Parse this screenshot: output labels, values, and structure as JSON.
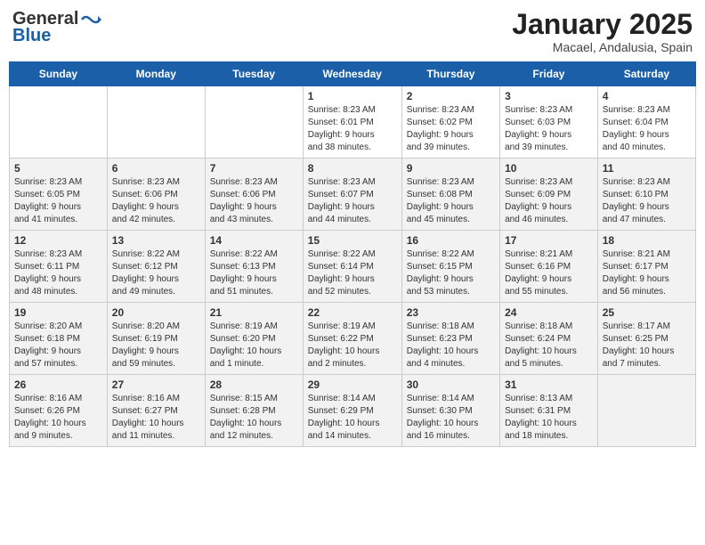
{
  "header": {
    "logo_general": "General",
    "logo_blue": "Blue",
    "month_title": "January 2025",
    "location": "Macael, Andalusia, Spain"
  },
  "days_of_week": [
    "Sunday",
    "Monday",
    "Tuesday",
    "Wednesday",
    "Thursday",
    "Friday",
    "Saturday"
  ],
  "weeks": [
    {
      "cells": [
        {
          "day": "",
          "info": ""
        },
        {
          "day": "",
          "info": ""
        },
        {
          "day": "",
          "info": ""
        },
        {
          "day": "1",
          "info": "Sunrise: 8:23 AM\nSunset: 6:01 PM\nDaylight: 9 hours\nand 38 minutes."
        },
        {
          "day": "2",
          "info": "Sunrise: 8:23 AM\nSunset: 6:02 PM\nDaylight: 9 hours\nand 39 minutes."
        },
        {
          "day": "3",
          "info": "Sunrise: 8:23 AM\nSunset: 6:03 PM\nDaylight: 9 hours\nand 39 minutes."
        },
        {
          "day": "4",
          "info": "Sunrise: 8:23 AM\nSunset: 6:04 PM\nDaylight: 9 hours\nand 40 minutes."
        }
      ]
    },
    {
      "cells": [
        {
          "day": "5",
          "info": "Sunrise: 8:23 AM\nSunset: 6:05 PM\nDaylight: 9 hours\nand 41 minutes."
        },
        {
          "day": "6",
          "info": "Sunrise: 8:23 AM\nSunset: 6:06 PM\nDaylight: 9 hours\nand 42 minutes."
        },
        {
          "day": "7",
          "info": "Sunrise: 8:23 AM\nSunset: 6:06 PM\nDaylight: 9 hours\nand 43 minutes."
        },
        {
          "day": "8",
          "info": "Sunrise: 8:23 AM\nSunset: 6:07 PM\nDaylight: 9 hours\nand 44 minutes."
        },
        {
          "day": "9",
          "info": "Sunrise: 8:23 AM\nSunset: 6:08 PM\nDaylight: 9 hours\nand 45 minutes."
        },
        {
          "day": "10",
          "info": "Sunrise: 8:23 AM\nSunset: 6:09 PM\nDaylight: 9 hours\nand 46 minutes."
        },
        {
          "day": "11",
          "info": "Sunrise: 8:23 AM\nSunset: 6:10 PM\nDaylight: 9 hours\nand 47 minutes."
        }
      ]
    },
    {
      "cells": [
        {
          "day": "12",
          "info": "Sunrise: 8:23 AM\nSunset: 6:11 PM\nDaylight: 9 hours\nand 48 minutes."
        },
        {
          "day": "13",
          "info": "Sunrise: 8:22 AM\nSunset: 6:12 PM\nDaylight: 9 hours\nand 49 minutes."
        },
        {
          "day": "14",
          "info": "Sunrise: 8:22 AM\nSunset: 6:13 PM\nDaylight: 9 hours\nand 51 minutes."
        },
        {
          "day": "15",
          "info": "Sunrise: 8:22 AM\nSunset: 6:14 PM\nDaylight: 9 hours\nand 52 minutes."
        },
        {
          "day": "16",
          "info": "Sunrise: 8:22 AM\nSunset: 6:15 PM\nDaylight: 9 hours\nand 53 minutes."
        },
        {
          "day": "17",
          "info": "Sunrise: 8:21 AM\nSunset: 6:16 PM\nDaylight: 9 hours\nand 55 minutes."
        },
        {
          "day": "18",
          "info": "Sunrise: 8:21 AM\nSunset: 6:17 PM\nDaylight: 9 hours\nand 56 minutes."
        }
      ]
    },
    {
      "cells": [
        {
          "day": "19",
          "info": "Sunrise: 8:20 AM\nSunset: 6:18 PM\nDaylight: 9 hours\nand 57 minutes."
        },
        {
          "day": "20",
          "info": "Sunrise: 8:20 AM\nSunset: 6:19 PM\nDaylight: 9 hours\nand 59 minutes."
        },
        {
          "day": "21",
          "info": "Sunrise: 8:19 AM\nSunset: 6:20 PM\nDaylight: 10 hours\nand 1 minute."
        },
        {
          "day": "22",
          "info": "Sunrise: 8:19 AM\nSunset: 6:22 PM\nDaylight: 10 hours\nand 2 minutes."
        },
        {
          "day": "23",
          "info": "Sunrise: 8:18 AM\nSunset: 6:23 PM\nDaylight: 10 hours\nand 4 minutes."
        },
        {
          "day": "24",
          "info": "Sunrise: 8:18 AM\nSunset: 6:24 PM\nDaylight: 10 hours\nand 5 minutes."
        },
        {
          "day": "25",
          "info": "Sunrise: 8:17 AM\nSunset: 6:25 PM\nDaylight: 10 hours\nand 7 minutes."
        }
      ]
    },
    {
      "cells": [
        {
          "day": "26",
          "info": "Sunrise: 8:16 AM\nSunset: 6:26 PM\nDaylight: 10 hours\nand 9 minutes."
        },
        {
          "day": "27",
          "info": "Sunrise: 8:16 AM\nSunset: 6:27 PM\nDaylight: 10 hours\nand 11 minutes."
        },
        {
          "day": "28",
          "info": "Sunrise: 8:15 AM\nSunset: 6:28 PM\nDaylight: 10 hours\nand 12 minutes."
        },
        {
          "day": "29",
          "info": "Sunrise: 8:14 AM\nSunset: 6:29 PM\nDaylight: 10 hours\nand 14 minutes."
        },
        {
          "day": "30",
          "info": "Sunrise: 8:14 AM\nSunset: 6:30 PM\nDaylight: 10 hours\nand 16 minutes."
        },
        {
          "day": "31",
          "info": "Sunrise: 8:13 AM\nSunset: 6:31 PM\nDaylight: 10 hours\nand 18 minutes."
        },
        {
          "day": "",
          "info": ""
        }
      ]
    }
  ]
}
